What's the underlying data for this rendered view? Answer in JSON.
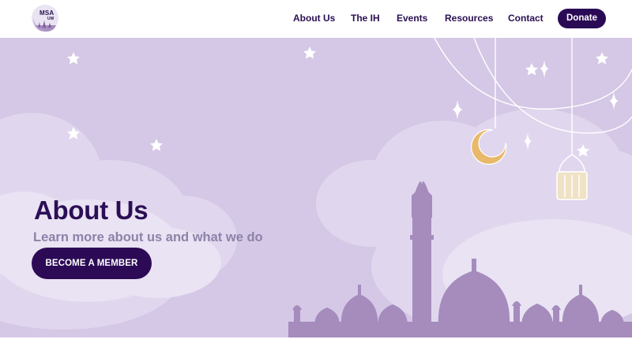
{
  "brand": {
    "logo_line1": "MSA",
    "logo_line2": "UW"
  },
  "nav": {
    "items": [
      {
        "label": "About Us"
      },
      {
        "label": "The IH"
      },
      {
        "label": "Events"
      },
      {
        "label": "Resources"
      },
      {
        "label": "Contact"
      }
    ],
    "donate_label": "Donate"
  },
  "hero": {
    "title": "About Us",
    "subtitle": "Learn more about us and what we do",
    "cta_label": "BECOME A MEMBER"
  },
  "colors": {
    "primary": "#2a0a55",
    "hero_bg": "#d4c8e6",
    "cloud": "#e4dcf0",
    "silhouette": "#a58cbd",
    "moon": "#e8b96a"
  },
  "icons": [
    "logo-icon",
    "star-icon",
    "sparkle-icon",
    "crescent-moon-icon",
    "lantern-icon",
    "mosque-silhouette"
  ]
}
